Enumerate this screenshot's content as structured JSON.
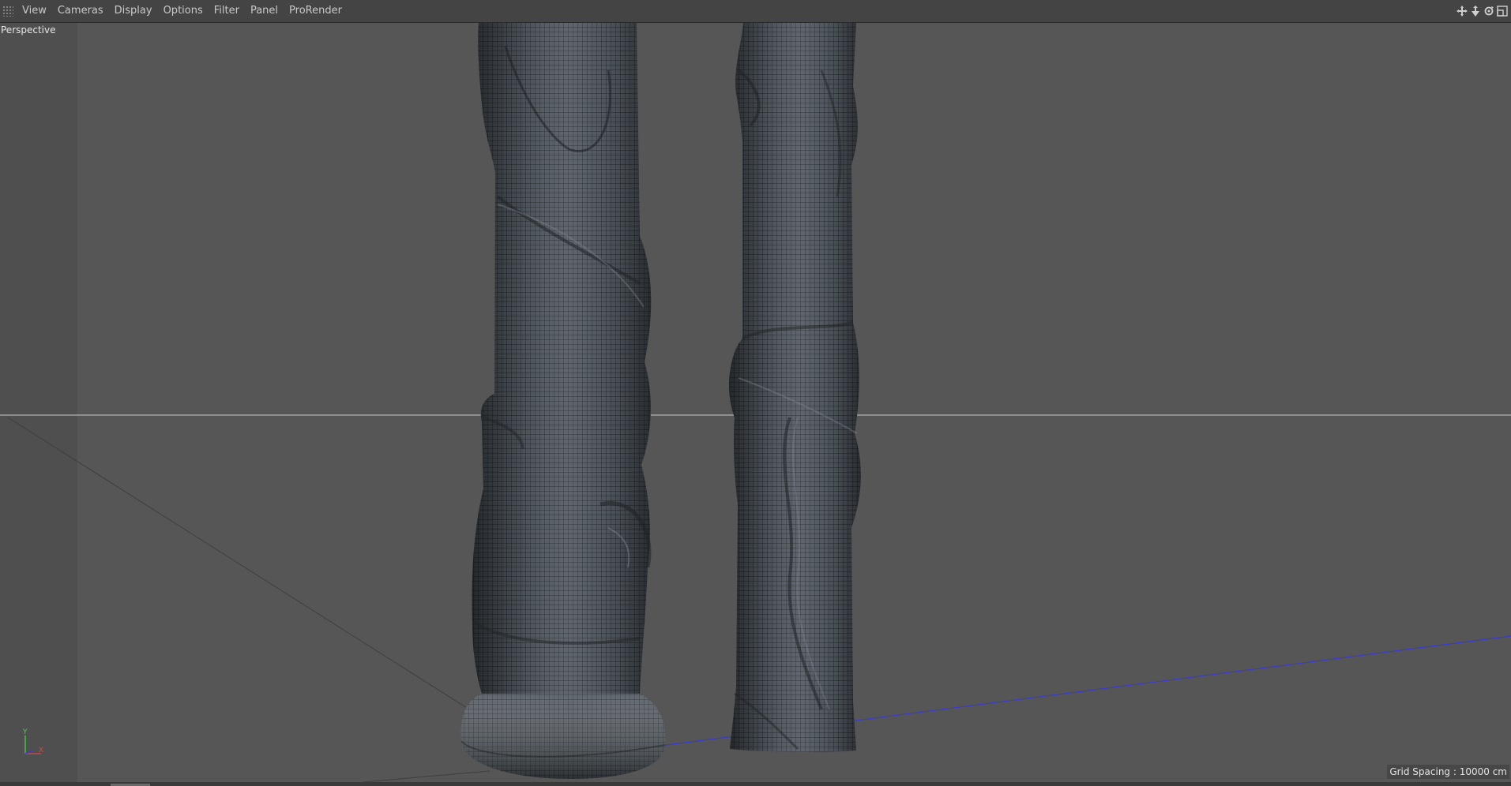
{
  "menubar": {
    "items": [
      "View",
      "Cameras",
      "Display",
      "Options",
      "Filter",
      "Panel",
      "ProRender"
    ],
    "nav_icons": [
      "move-icon",
      "dolly-icon",
      "rotate-icon",
      "maximize-icon"
    ]
  },
  "viewport": {
    "camera_label": "Perspective",
    "grid_spacing_label": "Grid Spacing : 10000 cm",
    "gizmo": {
      "y_label": "Y",
      "x_label": "X"
    }
  },
  "colors": {
    "background": "#565656",
    "menubar": "#444444",
    "mesh": "#4e545b",
    "wire": "#262a2e",
    "horizon": "#c8c8c8",
    "axis_blue": "#3a3ad0",
    "axis_green": "#4ad04a",
    "axis_red": "#d04a4a"
  }
}
